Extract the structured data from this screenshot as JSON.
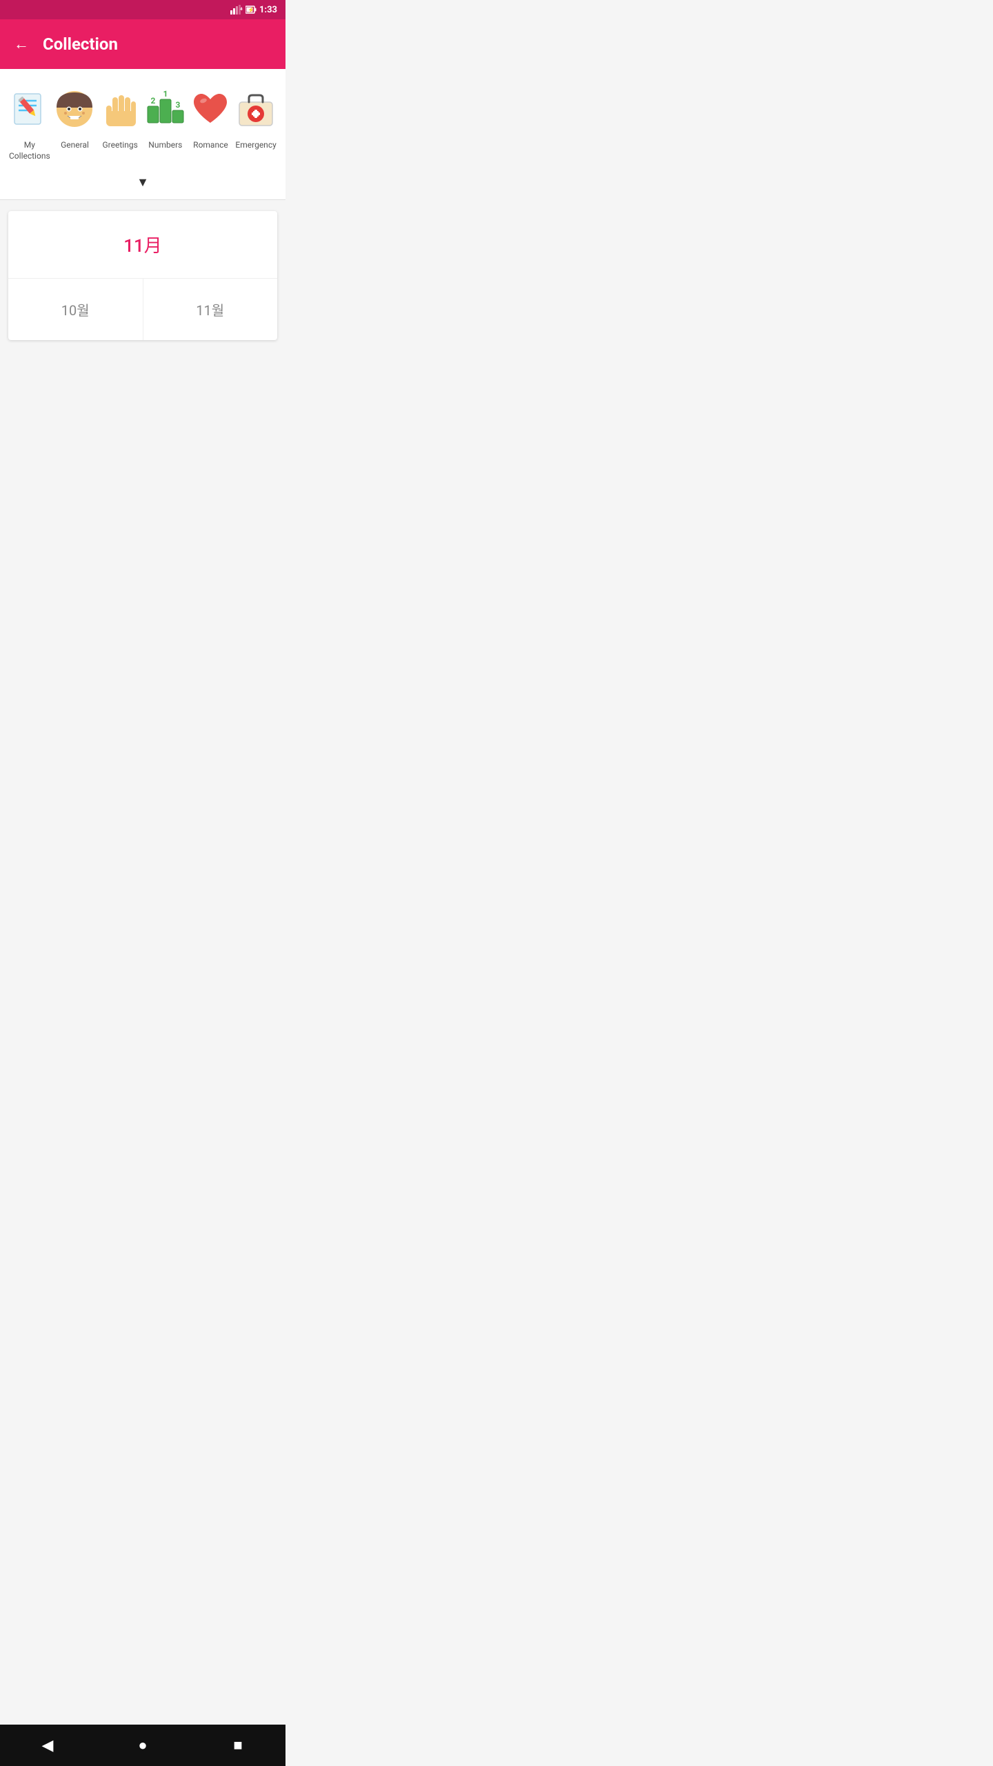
{
  "statusBar": {
    "network": "4G",
    "time": "1:33"
  },
  "header": {
    "title": "Collection",
    "backLabel": "←"
  },
  "categories": [
    {
      "id": "my-collections",
      "label": "My Collections",
      "icon": "notebook-pencil"
    },
    {
      "id": "general",
      "label": "General",
      "icon": "face-emoji"
    },
    {
      "id": "greetings",
      "label": "Greetings",
      "icon": "hand-wave"
    },
    {
      "id": "numbers",
      "label": "Numbers",
      "icon": "podium-numbers"
    },
    {
      "id": "romance",
      "label": "Romance",
      "icon": "heart"
    },
    {
      "id": "emergency",
      "label": "Emergency",
      "icon": "medical-kit"
    }
  ],
  "chevron": "▼",
  "calendar": {
    "currentMonth": "11月",
    "months": [
      {
        "label": "10월"
      },
      {
        "label": "11월"
      }
    ]
  },
  "bottomNav": {
    "back": "◀",
    "home": "●",
    "square": "■"
  }
}
